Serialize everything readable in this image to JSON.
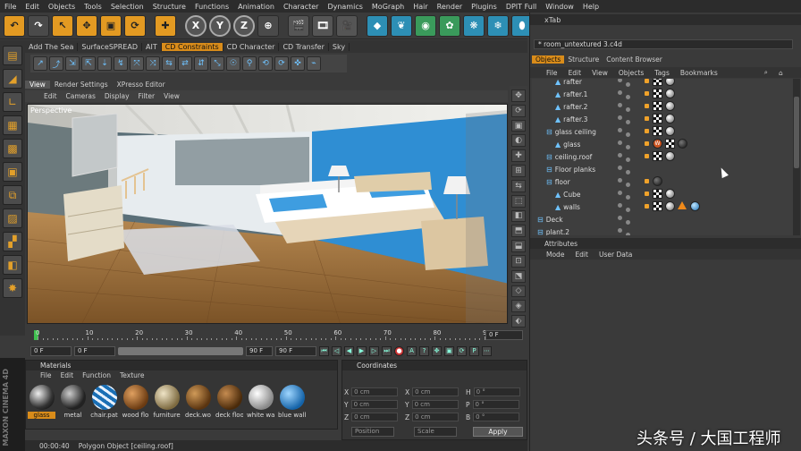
{
  "menu": [
    "File",
    "Edit",
    "Objects",
    "Tools",
    "Selection",
    "Structure",
    "Functions",
    "Animation",
    "Character",
    "Dynamics",
    "MoGraph",
    "Hair",
    "Render",
    "Plugins",
    "DPIT Full",
    "Window",
    "Help"
  ],
  "toolbar": {
    "buttons": [
      {
        "name": "undo-button",
        "glyph": "↶",
        "style": "orange"
      },
      {
        "name": "redo-button",
        "glyph": "↷",
        "style": ""
      },
      {
        "name": "live-selection-button",
        "glyph": "↖",
        "style": "orange"
      },
      {
        "name": "move-button",
        "glyph": "✥",
        "style": "orange"
      },
      {
        "name": "scale-button",
        "glyph": "▣",
        "style": "orange"
      },
      {
        "name": "rotate-button",
        "glyph": "⟳",
        "style": "orange"
      },
      {
        "name": "sep",
        "glyph": "",
        "style": "sep"
      },
      {
        "name": "world-axis-button",
        "glyph": "✚",
        "style": "orange"
      },
      {
        "name": "sep",
        "glyph": "",
        "style": "sep"
      },
      {
        "name": "x-axis-button",
        "glyph": "X",
        "style": "xyz"
      },
      {
        "name": "y-axis-button",
        "glyph": "Y",
        "style": "xyz"
      },
      {
        "name": "z-axis-button",
        "glyph": "Z",
        "style": "xyz"
      },
      {
        "name": "coordinate-system-button",
        "glyph": "⊕",
        "style": ""
      },
      {
        "name": "sep",
        "glyph": "",
        "style": "sep"
      },
      {
        "name": "render-view-button",
        "glyph": "🎬",
        "style": "film"
      },
      {
        "name": "render-picture-viewer-button",
        "glyph": "🎞",
        "style": "film"
      },
      {
        "name": "render-settings-button",
        "glyph": "🎥",
        "style": "film"
      },
      {
        "name": "sep",
        "glyph": "",
        "style": "sep"
      },
      {
        "name": "cube-button",
        "glyph": "◆",
        "style": "cyan"
      },
      {
        "name": "spline-button",
        "glyph": "❦",
        "style": "cyan"
      },
      {
        "name": "nurbs-button",
        "glyph": "◉",
        "style": "green"
      },
      {
        "name": "array-button",
        "glyph": "✿",
        "style": "green"
      },
      {
        "name": "deformer-button",
        "glyph": "❋",
        "style": "cyan"
      },
      {
        "name": "scene-button",
        "glyph": "❄",
        "style": "cyan"
      },
      {
        "name": "camera-button",
        "glyph": "⬮",
        "style": "cyan"
      },
      {
        "name": "light-button",
        "glyph": "✺",
        "style": "cyan"
      },
      {
        "name": "sep",
        "glyph": "",
        "style": "sep"
      },
      {
        "name": "help-button",
        "glyph": "?",
        "style": "orange"
      },
      {
        "name": "layout-button",
        "glyph": "▤",
        "style": ""
      }
    ]
  },
  "plugins": {
    "tabs": [
      "Add The Sea",
      "SurfaceSPREAD",
      "AIT",
      "CD Constraints",
      "CD Character",
      "CD Transfer",
      "Sky"
    ],
    "active_index": 3
  },
  "icon_row_count": 18,
  "left_tools": [
    {
      "name": "menu-icon",
      "glyph": "▤"
    },
    {
      "name": "model-tool-icon",
      "glyph": "◢"
    },
    {
      "name": "axis-tool-icon",
      "glyph": "∟"
    },
    {
      "name": "texture-tool-icon",
      "glyph": "▦"
    },
    {
      "name": "texture-axis-icon",
      "glyph": "▩"
    },
    {
      "name": "points-tool-icon",
      "glyph": "▣"
    },
    {
      "name": "edges-tool-icon",
      "glyph": "⧉"
    },
    {
      "name": "polygons-tool-icon",
      "glyph": "▨"
    },
    {
      "name": "uvw-points-icon",
      "glyph": "▞"
    },
    {
      "name": "uvw-polygons-icon",
      "glyph": "◧"
    },
    {
      "name": "snapping-icon",
      "glyph": "✸"
    }
  ],
  "viewport": {
    "tabs": [
      "View",
      "Render Settings",
      "XPresso Editor"
    ],
    "active_tab": 0,
    "menu": [
      "Edit",
      "Cameras",
      "Display",
      "Filter",
      "View"
    ],
    "label": "Perspective"
  },
  "timeline": {
    "ticks": [
      0,
      10,
      20,
      30,
      40,
      50,
      60,
      70,
      80,
      90
    ],
    "max": 90,
    "end_field": "0 F",
    "current_field": "0 F",
    "start_field": "0 F",
    "range_end": "90 F",
    "range_end2": "90 F"
  },
  "materials": {
    "title": "Materials",
    "menu": [
      "File",
      "Edit",
      "Function",
      "Texture"
    ],
    "items": [
      {
        "label": "glass",
        "ball": "glass",
        "selected": true
      },
      {
        "label": "metal",
        "ball": "metal",
        "selected": false
      },
      {
        "label": "chair.pat",
        "ball": "pattern",
        "selected": false
      },
      {
        "label": "wood flo",
        "ball": "wood",
        "selected": false
      },
      {
        "label": "furniture",
        "ball": "furniture",
        "selected": false
      },
      {
        "label": "deck.wo",
        "ball": "deck",
        "selected": false
      },
      {
        "label": "deck floo",
        "ball": "deckfloor",
        "selected": false
      },
      {
        "label": "white wa",
        "ball": "white",
        "selected": false
      },
      {
        "label": "blue wall",
        "ball": "blue",
        "selected": false
      }
    ]
  },
  "coordinates": {
    "title": "Coordinates",
    "rows": [
      [
        {
          "axis": "X",
          "value": "0 cm"
        },
        {
          "axis": "X",
          "value": "0 cm"
        },
        {
          "axis": "H",
          "value": "0 °"
        }
      ],
      [
        {
          "axis": "Y",
          "value": "0 cm"
        },
        {
          "axis": "Y",
          "value": "0 cm"
        },
        {
          "axis": "P",
          "value": "0 °"
        }
      ],
      [
        {
          "axis": "Z",
          "value": "0 cm"
        },
        {
          "axis": "Z",
          "value": "0 cm"
        },
        {
          "axis": "B",
          "value": "0 °"
        }
      ]
    ],
    "mode": "Position",
    "size_mode": "Scale",
    "apply_label": "Apply"
  },
  "status": {
    "time": "00:00:40",
    "message": "Polygon Object [ceiling.roof]"
  },
  "brand": "MAXON CINEMA 4D",
  "right_panel": {
    "tab": "xTab",
    "file": "* room_untextured 3.c4d",
    "tabs": [
      "Objects",
      "Structure",
      "Content Browser"
    ],
    "active_tab": 0,
    "menu": [
      "File",
      "Edit",
      "View",
      "Objects",
      "Tags",
      "Bookmarks"
    ],
    "objects": [
      {
        "label": "rafter",
        "indent": 2,
        "tags": [
          "checker",
          "sphere"
        ]
      },
      {
        "label": "rafter.1",
        "indent": 2,
        "tags": [
          "checker",
          "sphere"
        ]
      },
      {
        "label": "rafter.2",
        "indent": 2,
        "tags": [
          "checker",
          "sphere"
        ]
      },
      {
        "label": "rafter.3",
        "indent": 2,
        "tags": [
          "checker",
          "sphere"
        ]
      },
      {
        "label": "glass ceiling",
        "indent": 1,
        "tags": [
          "checker",
          "sphere"
        ]
      },
      {
        "label": "glass",
        "indent": 2,
        "tags": [
          "red",
          "checker",
          "dark"
        ]
      },
      {
        "label": "ceiling.roof",
        "indent": 1,
        "tags": [
          "checker",
          "sphere"
        ]
      },
      {
        "label": "Floor planks",
        "indent": 1,
        "tags": []
      },
      {
        "label": "floor",
        "indent": 1,
        "tags": [
          "dark"
        ]
      },
      {
        "label": "Cube",
        "indent": 2,
        "tags": [
          "checker",
          "sphere"
        ]
      },
      {
        "label": "walls",
        "indent": 2,
        "tags": [
          "checker",
          "sphere",
          "tri",
          "blue"
        ]
      },
      {
        "label": "Deck",
        "indent": 0,
        "tags": []
      },
      {
        "label": "plant.2",
        "indent": 0,
        "tags": []
      }
    ],
    "attributes_title": "Attributes",
    "attributes_menu": [
      "Mode",
      "Edit",
      "User Data"
    ]
  },
  "watermark": "头条号 / 大国工程师"
}
